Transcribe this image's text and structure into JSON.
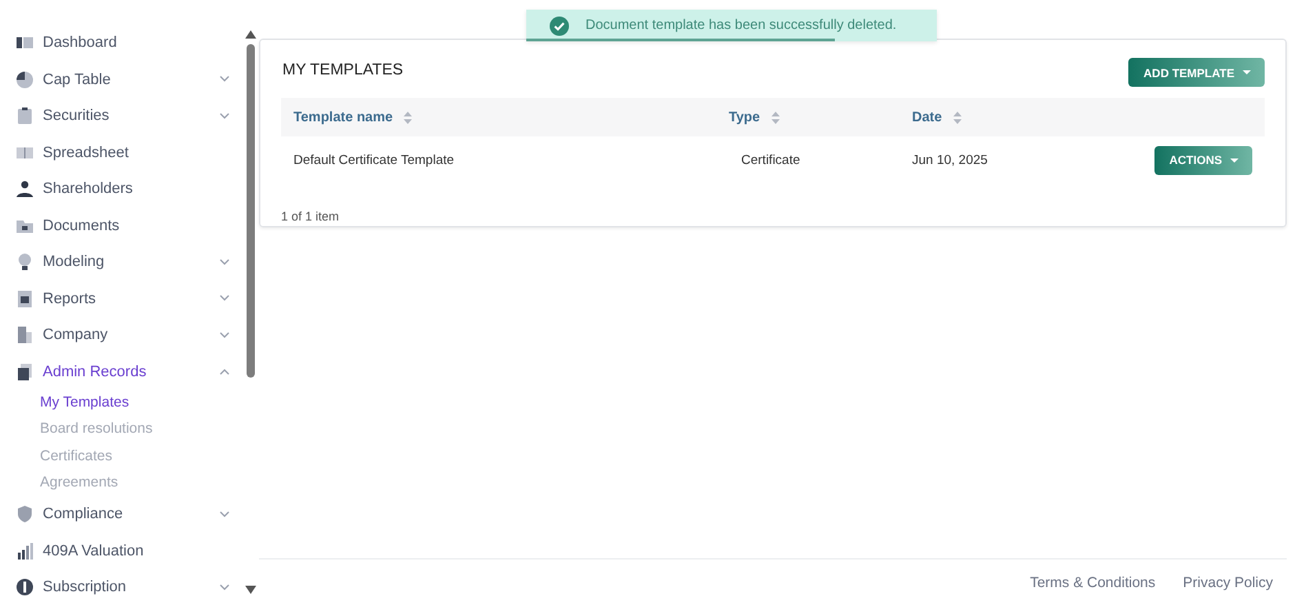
{
  "sidebar": {
    "items": [
      {
        "label": "Dashboard",
        "kind": "link",
        "selected": false
      },
      {
        "label": "Cap Table",
        "kind": "group",
        "expanded": false,
        "selected": false
      },
      {
        "label": "Securities",
        "kind": "group",
        "expanded": false,
        "selected": false
      },
      {
        "label": "Spreadsheet",
        "kind": "link",
        "selected": false
      },
      {
        "label": "Shareholders",
        "kind": "link",
        "selected": false
      },
      {
        "label": "Documents",
        "kind": "link",
        "selected": false
      },
      {
        "label": "Modeling",
        "kind": "group",
        "expanded": false,
        "selected": false
      },
      {
        "label": "Reports",
        "kind": "group",
        "expanded": false,
        "selected": false
      },
      {
        "label": "Company",
        "kind": "group",
        "expanded": false,
        "selected": false
      },
      {
        "label": "Admin Records",
        "kind": "group",
        "expanded": true,
        "selected": true,
        "children": [
          {
            "label": "My Templates",
            "selected": true
          },
          {
            "label": "Board resolutions",
            "selected": false
          },
          {
            "label": "Certificates",
            "selected": false
          },
          {
            "label": "Agreements",
            "selected": false
          }
        ]
      },
      {
        "label": "Compliance",
        "kind": "group",
        "expanded": false,
        "selected": false
      },
      {
        "label": "409A Valuation",
        "kind": "link",
        "selected": false
      },
      {
        "label": "Subscription",
        "kind": "group",
        "expanded": false,
        "selected": false
      }
    ]
  },
  "toast": {
    "message": "Document template has been successfully deleted.",
    "level": 0.75
  },
  "card": {
    "title": "MY TEMPLATES",
    "add_button": "ADD TEMPLATE",
    "columns": [
      "Template name",
      "Type",
      "Date"
    ],
    "rows": [
      {
        "cells": [
          "Default Certificate Template",
          "Certificate",
          "Jun 10, 2025"
        ],
        "action": "ACTIONS"
      }
    ],
    "pagination": "1 of 1 item"
  },
  "footer": {
    "links": [
      "Terms & Conditions",
      "Privacy Policy"
    ]
  }
}
